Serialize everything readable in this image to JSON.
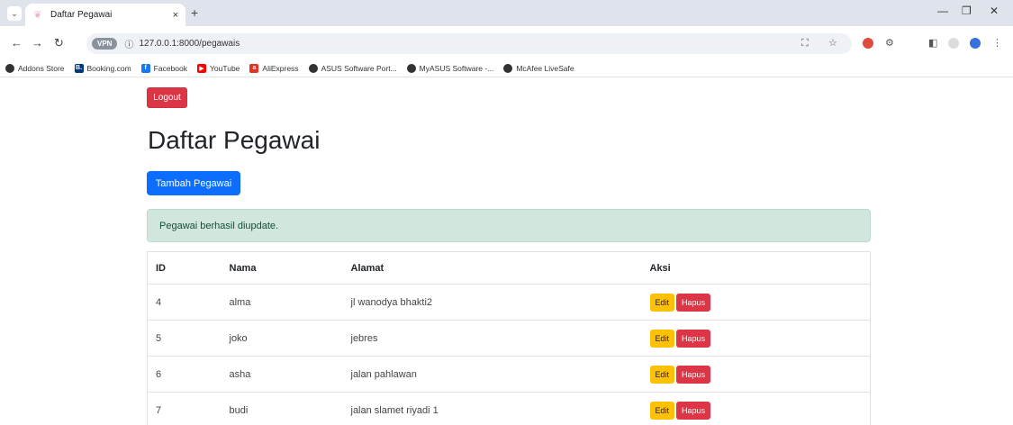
{
  "browser": {
    "tab_title": "Daftar Pegawai",
    "close_glyph": "×",
    "new_tab_glyph": "+",
    "url": "127.0.0.1:8000/pegawais",
    "vpn_label": "VPN",
    "bookmarks": [
      {
        "label": "Addons Store",
        "icon": "addons-icon",
        "color": "#333333",
        "glyph": ""
      },
      {
        "label": "Booking.com",
        "icon": "booking-icon",
        "color": "#003580",
        "glyph": "B."
      },
      {
        "label": "Facebook",
        "icon": "facebook-icon",
        "color": "#1877f2",
        "glyph": "f"
      },
      {
        "label": "YouTube",
        "icon": "youtube-icon",
        "color": "#ff0000",
        "glyph": "▶"
      },
      {
        "label": "AliExpress",
        "icon": "aliexpress-icon",
        "color": "#e43225",
        "glyph": "a"
      },
      {
        "label": "ASUS Software Port...",
        "icon": "globe-icon",
        "color": "#333333",
        "glyph": ""
      },
      {
        "label": "MyASUS Software -...",
        "icon": "globe-icon",
        "color": "#333333",
        "glyph": ""
      },
      {
        "label": "McAfee LiveSafe",
        "icon": "globe-icon",
        "color": "#333333",
        "glyph": ""
      }
    ]
  },
  "page": {
    "logout_label": "Logout",
    "title": "Daftar Pegawai",
    "add_label": "Tambah Pegawai",
    "alert": "Pegawai berhasil diupdate.",
    "table": {
      "headers": [
        "ID",
        "Nama",
        "Alamat",
        "Aksi"
      ],
      "rows": [
        {
          "id": "4",
          "nama": "alma",
          "alamat": "jl wanodya bhakti2"
        },
        {
          "id": "5",
          "nama": "joko",
          "alamat": "jebres"
        },
        {
          "id": "6",
          "nama": "asha",
          "alamat": "jalan pahlawan"
        },
        {
          "id": "7",
          "nama": "budi",
          "alamat": "jalan slamet riyadi 1"
        }
      ],
      "edit_label": "Edit",
      "delete_label": "Hapus"
    }
  },
  "colors": {
    "danger": "#dc3545",
    "primary": "#0d6efd",
    "warning": "#ffc107",
    "success_bg": "#d1e7dd"
  }
}
